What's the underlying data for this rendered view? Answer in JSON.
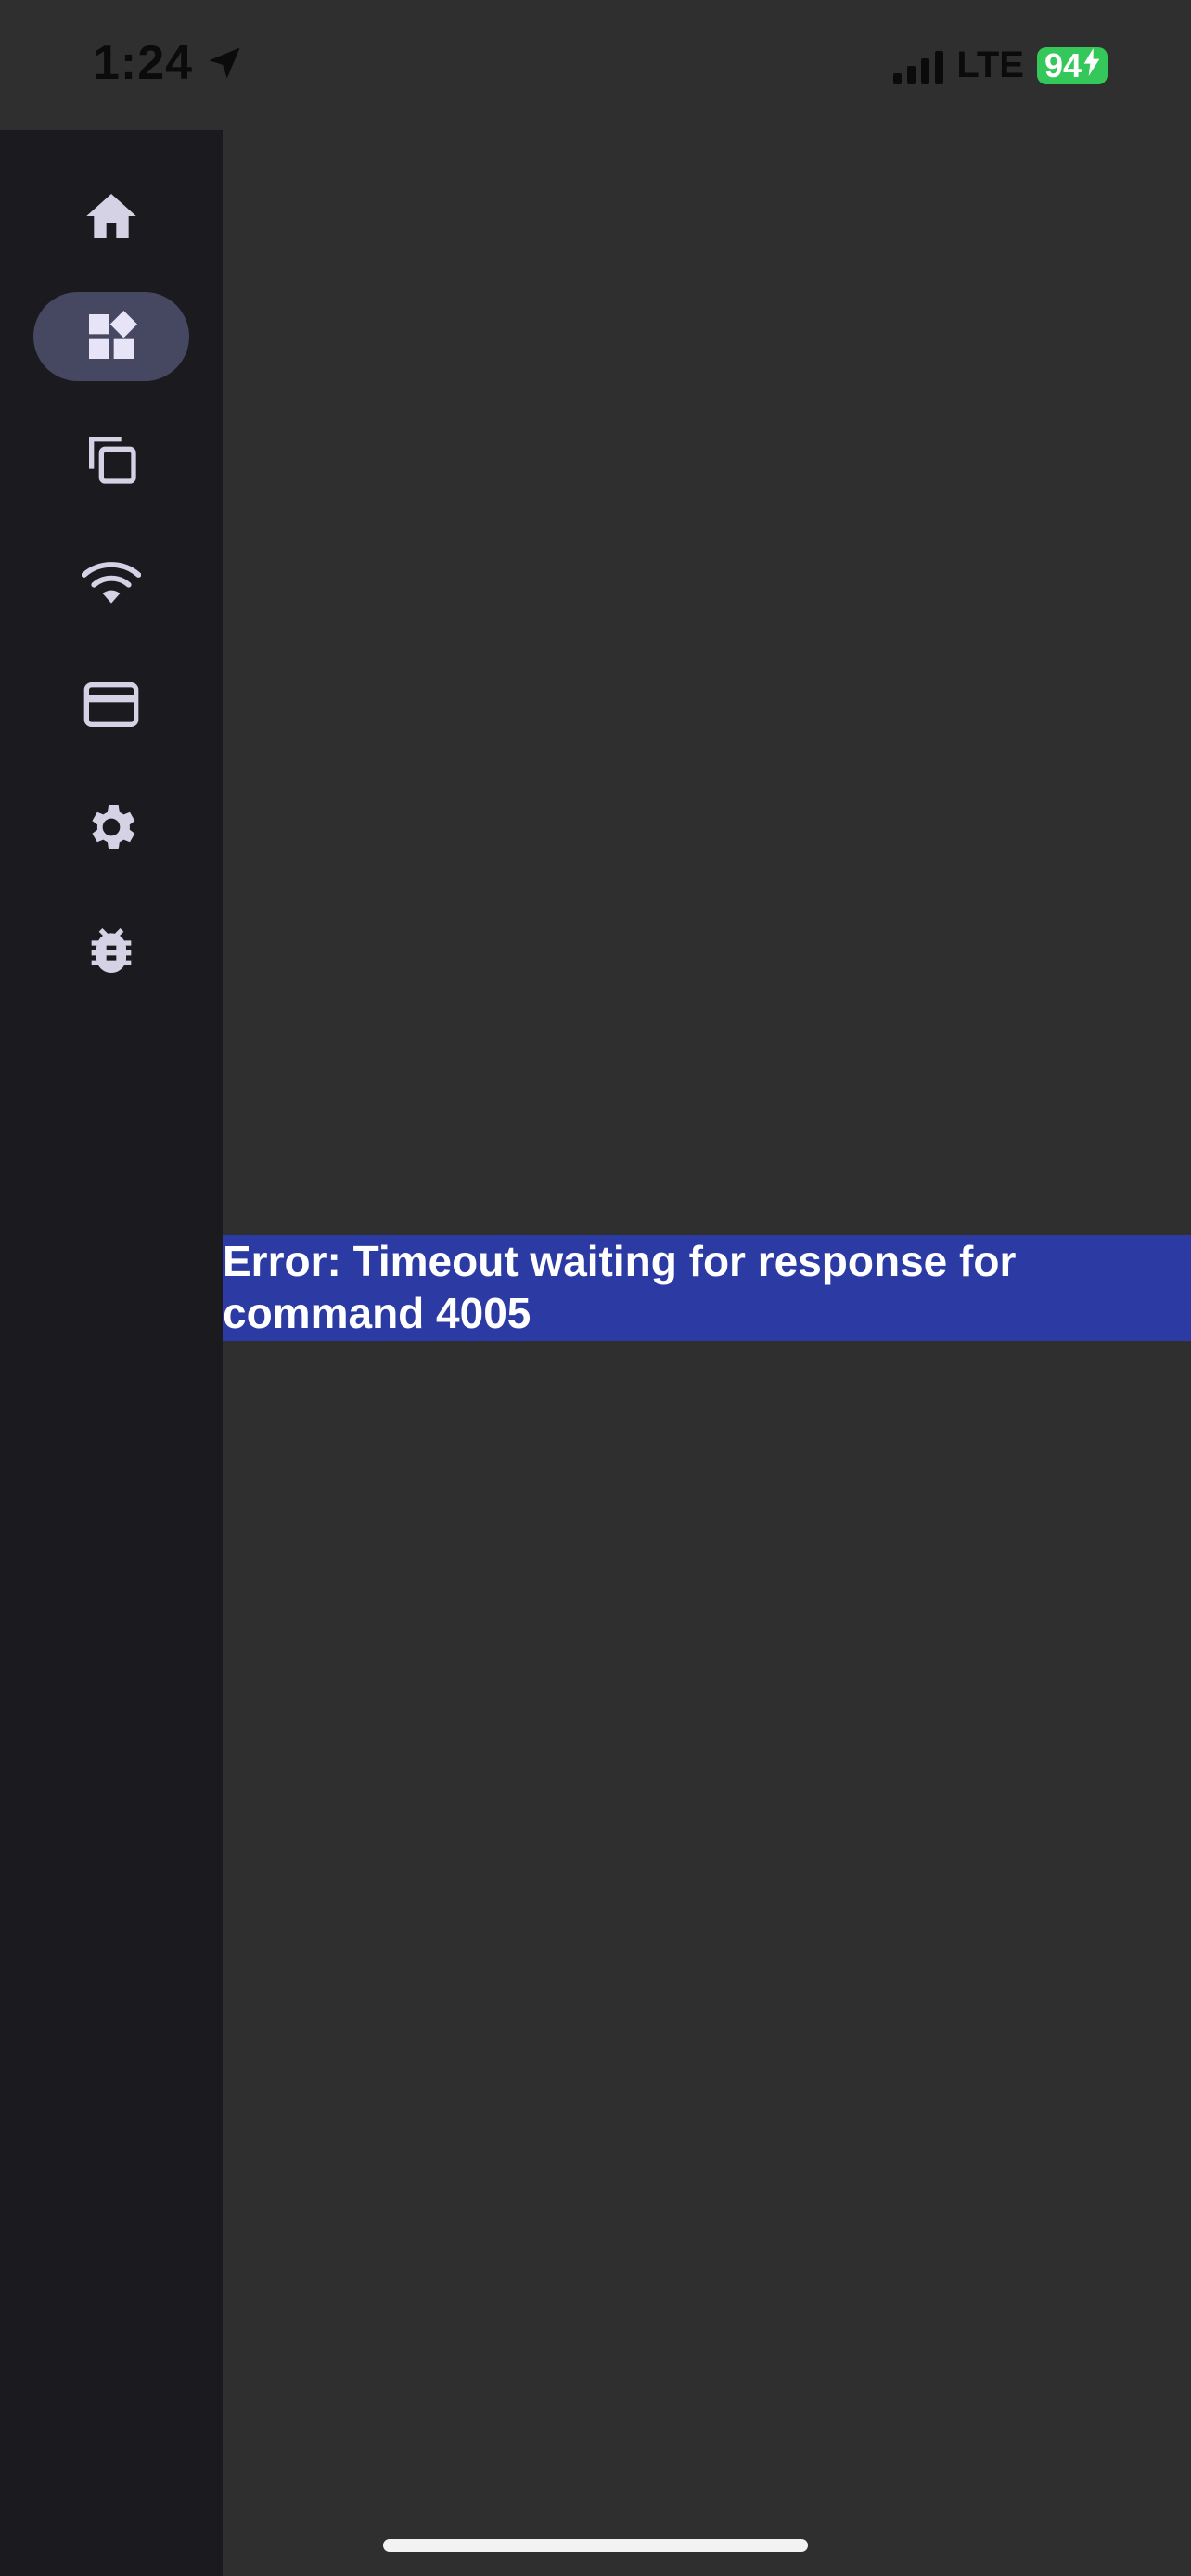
{
  "status_bar": {
    "time": "1:24",
    "location_icon": "location-arrow-icon",
    "signal_icon": "cellular-signal-icon",
    "network": "LTE",
    "battery": "94",
    "battery_charging_icon": "bolt-icon",
    "battery_color": "#34c759"
  },
  "sidebar": {
    "background": "#1b1b1f",
    "active_pill_color": "#454860",
    "items": [
      {
        "name": "home",
        "icon": "home-icon",
        "active": false
      },
      {
        "name": "widgets",
        "icon": "widgets-icon",
        "active": true
      },
      {
        "name": "copy",
        "icon": "copy-icon",
        "active": false
      },
      {
        "name": "wifi",
        "icon": "wifi-icon",
        "active": false
      },
      {
        "name": "card",
        "icon": "credit-card-icon",
        "active": false
      },
      {
        "name": "settings",
        "icon": "gear-icon",
        "active": false
      },
      {
        "name": "debug",
        "icon": "bug-icon",
        "active": false
      }
    ]
  },
  "main": {
    "error_message": "Error: Timeout waiting for response for command 4005",
    "error_banner_color": "#2b3ba3"
  }
}
